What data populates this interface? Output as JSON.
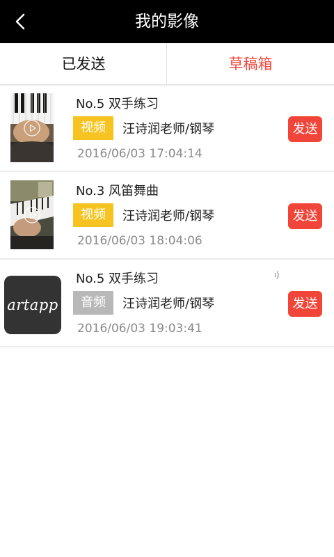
{
  "header": {
    "title": "我的影像",
    "back_icon": "chevron-left-icon"
  },
  "tabs": [
    {
      "label": "已发送",
      "active": false
    },
    {
      "label": "草稿箱",
      "active": true,
      "color": "#ef4a3e"
    }
  ],
  "items": [
    {
      "title": "No.5  双手练习",
      "type": "视频",
      "teacher": "汪诗润老师/钢琴",
      "date": "2016/06/03 17:04:14",
      "send_label": "发送",
      "thumb_icon": "play-icon"
    },
    {
      "title": "No.3  风笛舞曲",
      "type": "视频",
      "teacher": "汪诗润老师/钢琴",
      "date": "2016/06/03 18:04:06",
      "send_label": "发送",
      "thumb_icon": "play-icon"
    },
    {
      "title": "No.5  双手练习",
      "type": "音频",
      "teacher": "汪诗润老师/钢琴",
      "date": "2016/06/03 19:03:41",
      "send_label": "发送",
      "logo_text": "artapp",
      "status_icon": "sound-wave-icon"
    }
  ],
  "colors": {
    "titlebar": "#000000",
    "accent_red": "#f2453a",
    "video_badge": "#f7c320",
    "audio_badge": "#b8b8b8"
  }
}
